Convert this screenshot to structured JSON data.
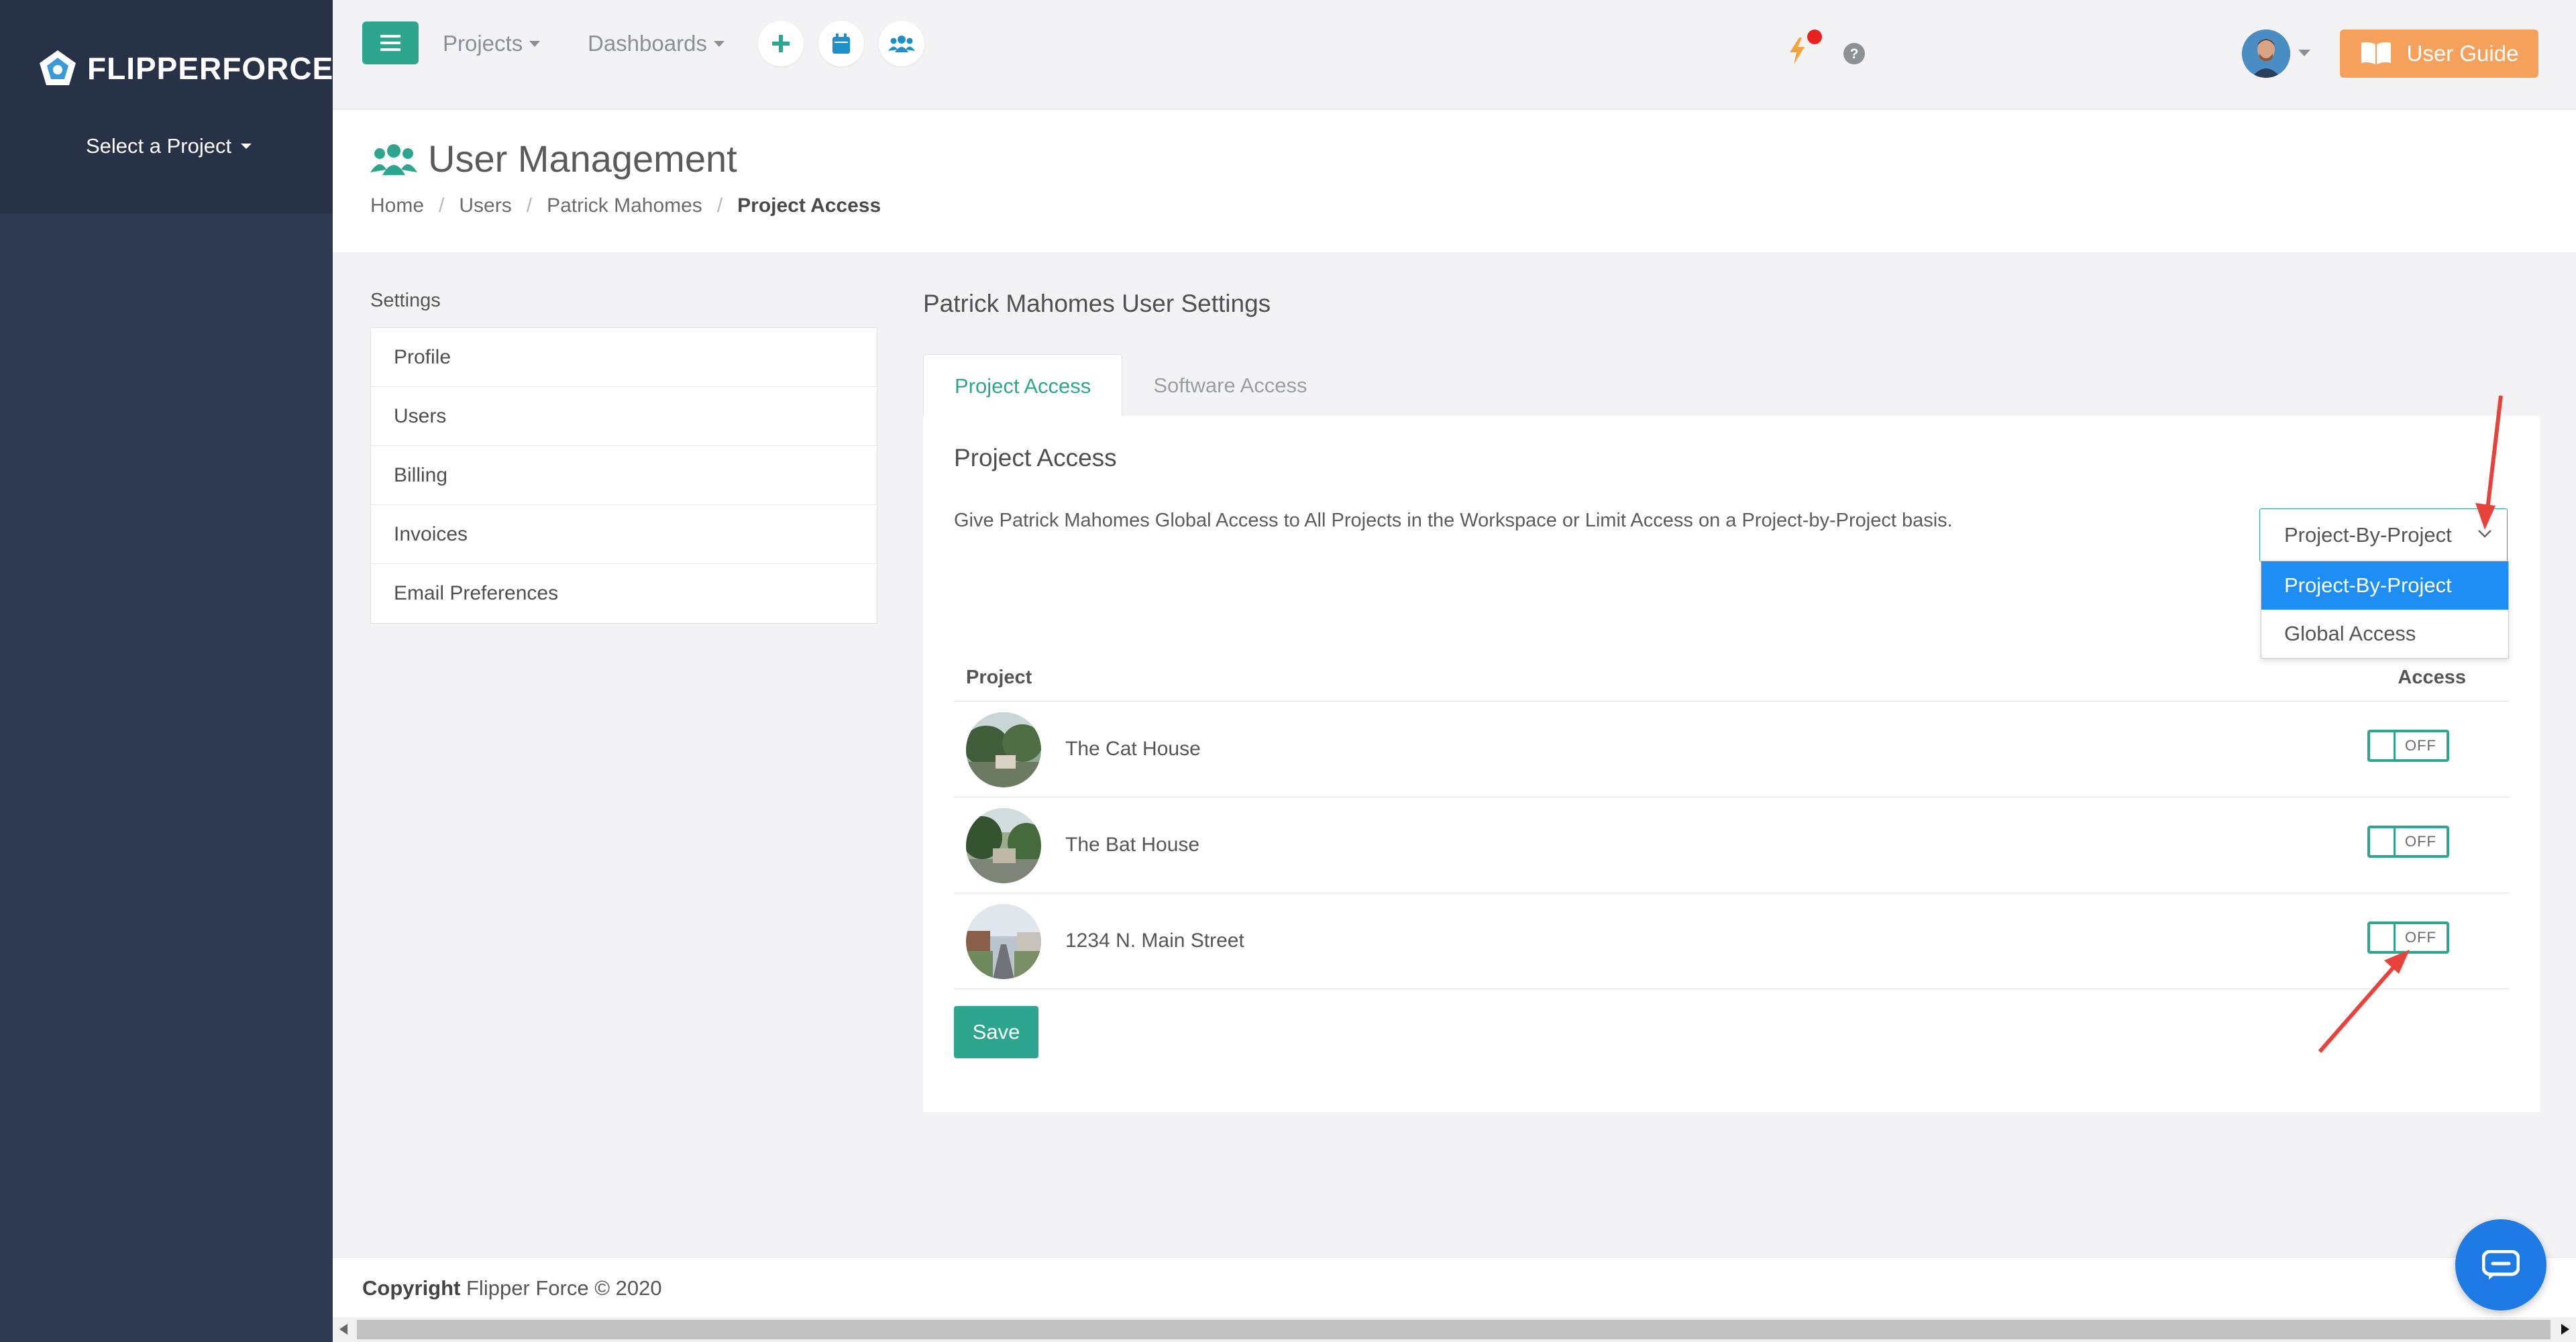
{
  "brand": {
    "name": "FLIPPERFORCE",
    "icon": "pentagon-logo-icon"
  },
  "sidebar": {
    "project_select_label": "Select a Project"
  },
  "topbar": {
    "menu_icon": "hamburger-icon",
    "projects_label": "Projects",
    "dashboards_label": "Dashboards",
    "add_icon": "plus-icon",
    "calendar_icon": "calendar-icon",
    "team_icon": "users-icon",
    "notification_icon": "lightning-icon",
    "help_icon": "question-circle-icon",
    "user_guide_label": "User Guide"
  },
  "header": {
    "title": "User Management",
    "breadcrumb": [
      "Home",
      "Users",
      "Patrick Mahomes",
      "Project Access"
    ]
  },
  "settings": {
    "label": "Settings",
    "items": [
      "Profile",
      "Users",
      "Billing",
      "Invoices",
      "Email Preferences"
    ]
  },
  "main": {
    "title": "Patrick Mahomes User Settings",
    "tabs": [
      {
        "label": "Project Access",
        "active": true
      },
      {
        "label": "Software Access",
        "active": false
      }
    ],
    "panel": {
      "title": "Project Access",
      "description": "Give Patrick Mahomes Global Access to All Projects in the Workspace or Limit Access on a Project-by-Project basis.",
      "select": {
        "value": "Project-By-Project",
        "options": [
          "Project-By-Project",
          "Global Access"
        ]
      },
      "table": {
        "headers": {
          "project": "Project",
          "access": "Access"
        },
        "rows": [
          {
            "name": "The Cat House",
            "access": "OFF"
          },
          {
            "name": "The Bat House",
            "access": "OFF"
          },
          {
            "name": "1234 N. Main Street",
            "access": "OFF"
          }
        ]
      },
      "save_label": "Save"
    }
  },
  "footer": {
    "copyright_bold": "Copyright",
    "copyright_rest": "Flipper Force © 2020"
  },
  "colors": {
    "accent": "#2ea58f",
    "sidebar": "#2e3a52",
    "guide": "#f5a15c",
    "selected": "#1e8ef5",
    "annotation": "#e8433a"
  }
}
